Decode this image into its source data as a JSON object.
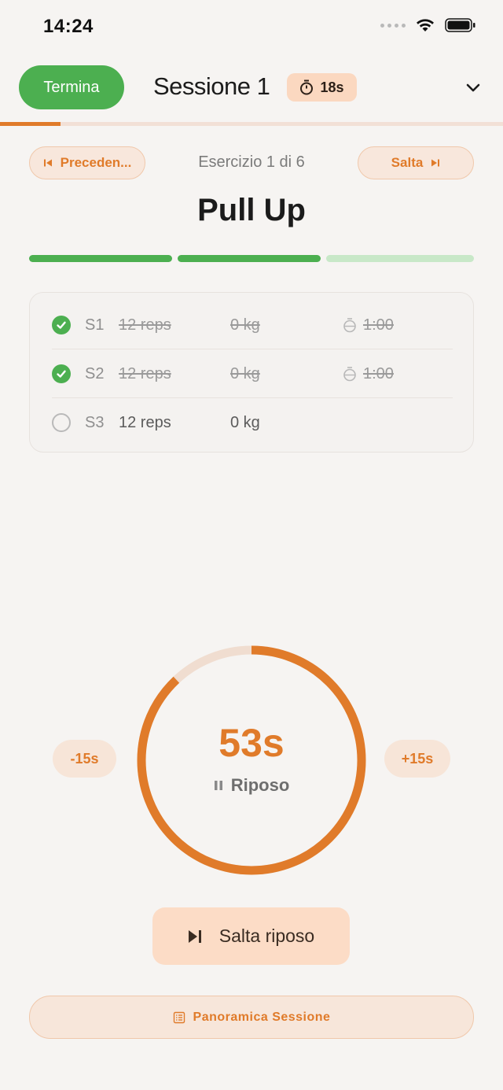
{
  "status_bar": {
    "time": "14:24"
  },
  "header": {
    "end_label": "Termina",
    "session_title": "Sessione 1",
    "timer_badge": "18s"
  },
  "session_progress": {
    "fraction": 0.12
  },
  "navigation": {
    "prev_label": "Preceden...",
    "counter": "Esercizio 1 di 6",
    "skip_label": "Salta"
  },
  "exercise": {
    "name": "Pull Up",
    "set_progress": [
      "done",
      "done",
      "pending"
    ]
  },
  "sets": [
    {
      "label": "S1",
      "reps": "12 reps",
      "weight": "0 kg",
      "rest": "1:00",
      "completed": true
    },
    {
      "label": "S2",
      "reps": "12 reps",
      "weight": "0 kg",
      "rest": "1:00",
      "completed": true
    },
    {
      "label": "S3",
      "reps": "12 reps",
      "weight": "0 kg",
      "rest": "",
      "completed": false
    }
  ],
  "rest_timer": {
    "value": "53s",
    "label": "Riposo",
    "minus_label": "-15s",
    "plus_label": "+15s",
    "remaining_fraction": 0.88,
    "accent_color": "#e07b2a",
    "track_color": "#f0ddd0"
  },
  "actions": {
    "skip_rest_label": "Salta riposo",
    "overview_label": "Panoramica Sessione"
  },
  "colors": {
    "green": "#4caf50",
    "orange": "#e07b2a"
  }
}
